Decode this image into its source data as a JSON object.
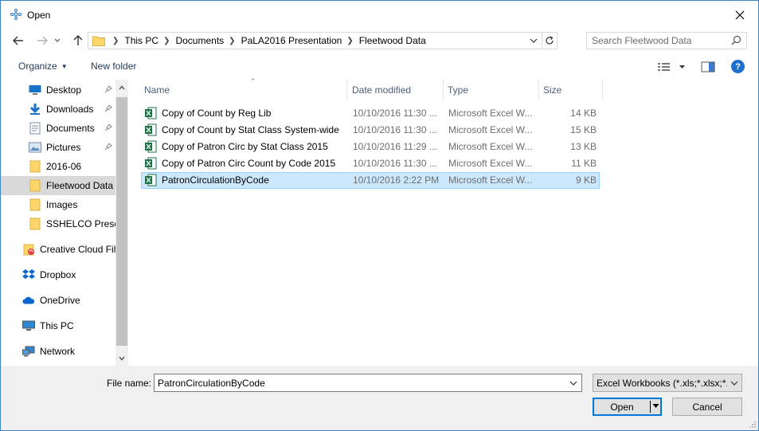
{
  "window": {
    "title": "Open"
  },
  "address": {
    "crumbs": [
      "This PC",
      "Documents",
      "PaLA2016 Presentation",
      "Fleetwood Data"
    ]
  },
  "search": {
    "placeholder": "Search Fleetwood Data"
  },
  "toolbar": {
    "organize_label": "Organize",
    "new_folder_label": "New folder"
  },
  "sidebar": {
    "items": [
      {
        "label": "Desktop",
        "icon": "desktop-icon",
        "pinned": true
      },
      {
        "label": "Downloads",
        "icon": "download-icon",
        "pinned": true
      },
      {
        "label": "Documents",
        "icon": "documents-icon",
        "pinned": true
      },
      {
        "label": "Pictures",
        "icon": "pictures-icon",
        "pinned": true
      },
      {
        "label": "2016-06",
        "icon": "folder-icon",
        "pinned": false
      },
      {
        "label": "Fleetwood Data",
        "icon": "folder-icon",
        "pinned": false,
        "selected": true
      },
      {
        "label": "Images",
        "icon": "folder-icon",
        "pinned": false
      },
      {
        "label": "SSHELCO Preser",
        "icon": "folder-icon",
        "pinned": false
      },
      {
        "label": "Creative Cloud Fil",
        "icon": "creative-cloud-icon"
      },
      {
        "label": "Dropbox",
        "icon": "dropbox-icon"
      },
      {
        "label": "OneDrive",
        "icon": "onedrive-icon"
      },
      {
        "label": "This PC",
        "icon": "computer-icon"
      },
      {
        "label": "Network",
        "icon": "network-icon"
      }
    ]
  },
  "columns": {
    "name": "Name",
    "date": "Date modified",
    "type": "Type",
    "size": "Size"
  },
  "files": [
    {
      "name": "Copy of Count by Reg  Lib",
      "date": "10/10/2016 11:30 ...",
      "type": "Microsoft Excel W...",
      "size": "14 KB"
    },
    {
      "name": "Copy of Count by Stat Class System-wide",
      "date": "10/10/2016 11:30 ...",
      "type": "Microsoft Excel W...",
      "size": "15 KB"
    },
    {
      "name": "Copy of Patron Circ by Stat Class 2015",
      "date": "10/10/2016 11:29 ...",
      "type": "Microsoft Excel W...",
      "size": "13 KB"
    },
    {
      "name": "Copy of Patron Circ Count by Code 2015",
      "date": "10/10/2016 11:30 ...",
      "type": "Microsoft Excel W...",
      "size": "11 KB"
    },
    {
      "name": "PatronCirculationByCode",
      "date": "10/10/2016 2:22 PM",
      "type": "Microsoft Excel W...",
      "size": "9 KB",
      "selected": true
    }
  ],
  "footer": {
    "file_name_label": "File name:",
    "file_name_value": "PatronCirculationByCode",
    "file_type": "Excel Workbooks (*.xls;*.xlsx;*.xl",
    "open_label": "Open",
    "cancel_label": "Cancel"
  },
  "colors": {
    "accent": "#0078d7",
    "selection": "#cce8ff",
    "selection_border": "#99d1ff",
    "folder": "#ffd66a"
  }
}
